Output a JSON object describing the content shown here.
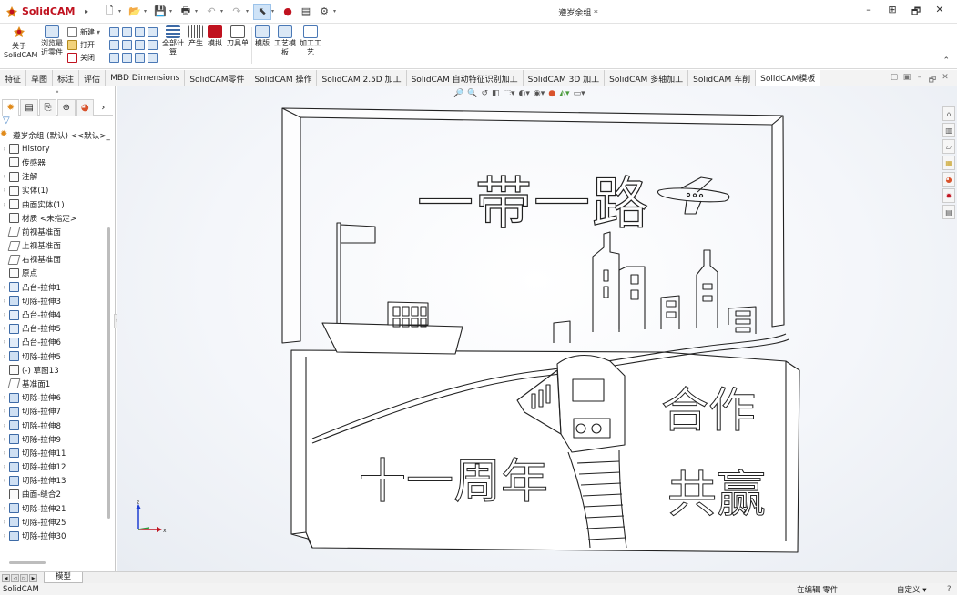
{
  "app": {
    "brand": "SolidCAM",
    "document_title": "遵岁余组 *",
    "accent_color": "#c0121f"
  },
  "quick_access": {
    "icons": [
      "new-icon",
      "open-icon",
      "save-icon",
      "print-icon",
      "undo-icon",
      "redo-icon",
      "select-icon",
      "rebuild-icon",
      "file-properties-icon",
      "options-icon"
    ]
  },
  "window_controls": {
    "minimize": "–",
    "layout": "⊞",
    "restore": "🗗",
    "close": "✕"
  },
  "command_manager": {
    "about": "关于\nSolidCAM",
    "browse_recent": "浏览最\n近零件",
    "new": "新建",
    "open": "打开",
    "close": "关闭",
    "calc_all": "全部计\n算",
    "generate": "产生",
    "simulate": "模拟",
    "tool_sheet": "刀具单",
    "template": "模版",
    "process_template": "工艺模\n板",
    "machining_process": "加工工\n艺"
  },
  "tabs": [
    {
      "label": "特征",
      "active": false
    },
    {
      "label": "草图",
      "active": false
    },
    {
      "label": "标注",
      "active": false
    },
    {
      "label": "评估",
      "active": false
    },
    {
      "label": "MBD Dimensions",
      "active": false
    },
    {
      "label": "SolidCAM零件",
      "active": false
    },
    {
      "label": "SolidCAM 操作",
      "active": false
    },
    {
      "label": "SolidCAM 2.5D 加工",
      "active": false
    },
    {
      "label": "SolidCAM 自动特征识别加工",
      "active": false
    },
    {
      "label": "SolidCAM 3D 加工",
      "active": false
    },
    {
      "label": "SolidCAM 多轴加工",
      "active": false
    },
    {
      "label": "SolidCAM 车削",
      "active": false
    },
    {
      "label": "SolidCAM模板",
      "active": true
    }
  ],
  "feature_tree": {
    "root": "遵岁余组 (默认) <<默认>_",
    "items": [
      {
        "label": "History",
        "icon": "history-icon",
        "expand": true
      },
      {
        "label": "传感器",
        "icon": "sensor-icon",
        "expand": false
      },
      {
        "label": "注解",
        "icon": "annotation-icon",
        "expand": true
      },
      {
        "label": "实体(1)",
        "icon": "solid-bodies-icon",
        "expand": true
      },
      {
        "label": "曲面实体(1)",
        "icon": "surface-bodies-icon",
        "expand": true
      },
      {
        "label": "材质 <未指定>",
        "icon": "material-icon",
        "expand": false
      },
      {
        "label": "前视基准面",
        "icon": "plane-icon",
        "expand": false
      },
      {
        "label": "上视基准面",
        "icon": "plane-icon",
        "expand": false
      },
      {
        "label": "右视基准面",
        "icon": "plane-icon",
        "expand": false
      },
      {
        "label": "原点",
        "icon": "origin-icon",
        "expand": false
      },
      {
        "label": "凸台-拉伸1",
        "icon": "boss-extrude-icon",
        "expand": true
      },
      {
        "label": "切除-拉伸3",
        "icon": "cut-extrude-icon",
        "expand": true
      },
      {
        "label": "凸台-拉伸4",
        "icon": "boss-extrude-icon",
        "expand": true
      },
      {
        "label": "凸台-拉伸5",
        "icon": "boss-extrude-icon",
        "expand": true
      },
      {
        "label": "凸台-拉伸6",
        "icon": "boss-extrude-icon",
        "expand": true
      },
      {
        "label": "切除-拉伸5",
        "icon": "cut-extrude-icon",
        "expand": true
      },
      {
        "label": "(-) 草图13",
        "icon": "sketch-icon",
        "expand": false
      },
      {
        "label": "基准面1",
        "icon": "plane-icon",
        "expand": false
      },
      {
        "label": "切除-拉伸6",
        "icon": "cut-extrude-icon",
        "expand": true
      },
      {
        "label": "切除-拉伸7",
        "icon": "cut-extrude-icon",
        "expand": true
      },
      {
        "label": "切除-拉伸8",
        "icon": "cut-extrude-icon",
        "expand": true
      },
      {
        "label": "切除-拉伸9",
        "icon": "cut-extrude-icon",
        "expand": true
      },
      {
        "label": "切除-拉伸11",
        "icon": "cut-extrude-icon",
        "expand": true
      },
      {
        "label": "切除-拉伸12",
        "icon": "cut-extrude-icon",
        "expand": true
      },
      {
        "label": "切除-拉伸13",
        "icon": "cut-extrude-icon",
        "expand": true
      },
      {
        "label": "曲面-缝合2",
        "icon": "surface-knit-icon",
        "expand": false
      },
      {
        "label": "切除-拉伸21",
        "icon": "cut-extrude-icon",
        "expand": true
      },
      {
        "label": "切除-拉伸25",
        "icon": "cut-extrude-icon",
        "expand": true
      },
      {
        "label": "切除-拉伸30",
        "icon": "cut-extrude-icon",
        "expand": true
      }
    ]
  },
  "model_text": {
    "top_banner": "一带一路",
    "left_caption": "十一周年",
    "right_caption_1": "合作",
    "right_caption_2": "共赢"
  },
  "triad": {
    "z": "z",
    "x": "x"
  },
  "sheet_tabs": [
    "模型"
  ],
  "status": {
    "left": "SolidCAM",
    "editing": "在编辑 零件",
    "units": "自定义",
    "units_caret": "▾"
  }
}
